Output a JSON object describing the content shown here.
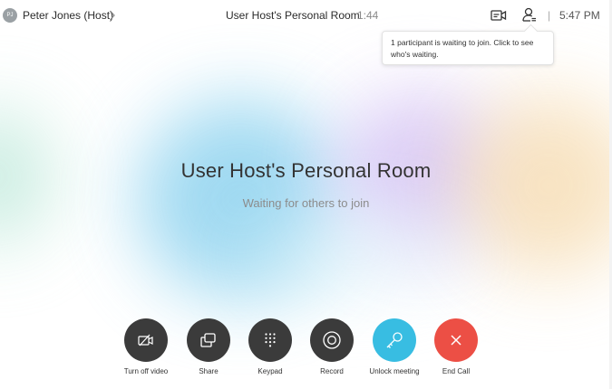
{
  "header": {
    "avatar_initials": "PJ",
    "host_name": "Peter Jones (Host)",
    "meeting_title": "User Host's Personal Room",
    "duration": "1:44",
    "separator": "|",
    "clock": "5:47 PM"
  },
  "tooltip": {
    "text": "1 participant is waiting to join. Click to see who's waiting."
  },
  "main": {
    "room_title": "User Host's Personal Room",
    "subtitle": "Waiting for others to join"
  },
  "controls": [
    {
      "label": "Turn off video",
      "icon": "video-off-icon"
    },
    {
      "label": "Share",
      "icon": "share-icon"
    },
    {
      "label": "Keypad",
      "icon": "keypad-icon"
    },
    {
      "label": "Record",
      "icon": "record-icon"
    },
    {
      "label": "Unlock meeting",
      "icon": "key-icon"
    },
    {
      "label": "End Call",
      "icon": "end-call-icon"
    }
  ],
  "colors": {
    "control_dark": "#3b3b3b",
    "unlock_accent": "#38bde2",
    "end_call": "#ec4f45"
  }
}
